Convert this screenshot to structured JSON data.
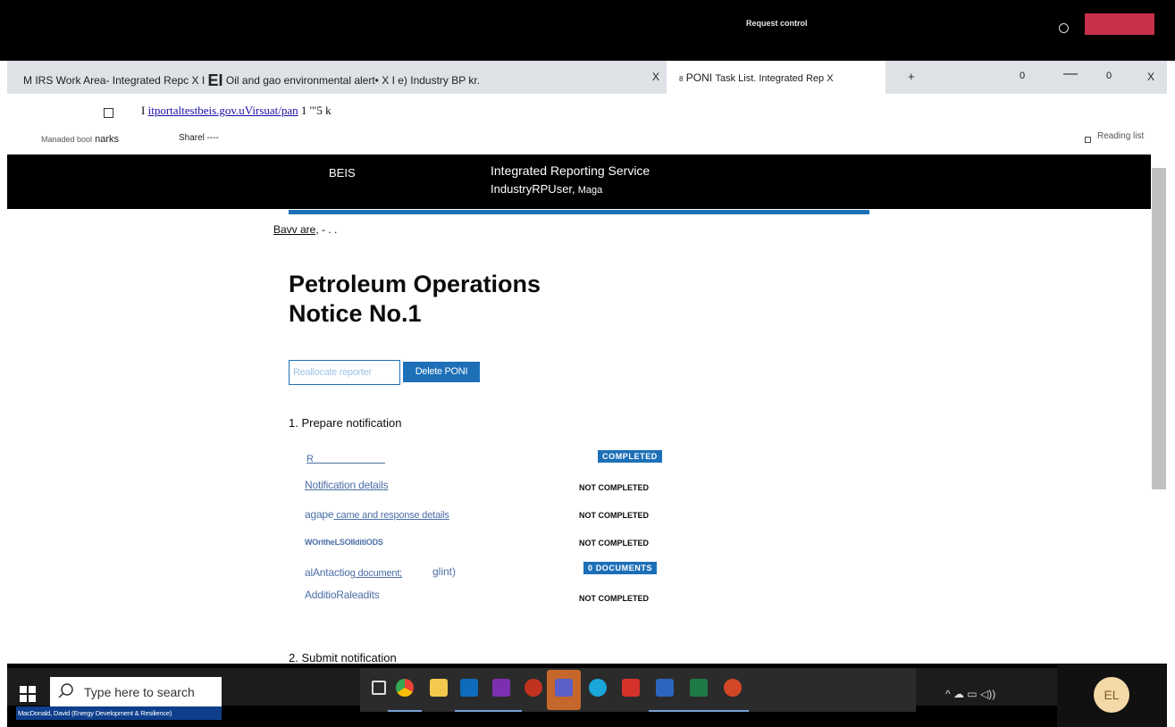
{
  "remote": {
    "request_control": "Request control"
  },
  "tabs": {
    "tab1": "M IRS Work Area- Integrated Repc X I",
    "tab2_mark": "EI",
    "tab2": " Oil and gao environmental alert• X",
    "tab3": " I e) Industry BP kr.",
    "tab_close": "X",
    "tab4_prefix": "8",
    "tab4": " PONI ",
    "tab4_rest": "Task List. Integrated Rep X",
    "new_tab": "+",
    "win_a": "0",
    "win_min": "—",
    "win_b": "0",
    "win_close": "X"
  },
  "address": {
    "prefix": "I ",
    "url": "itportaltestbeis.gov.uVirsuat/pan",
    "suffix": " 1 '\"5      k"
  },
  "bookmarks": {
    "managed_a": "Manaded bool",
    "managed_b": " narks",
    "share": "Sharel ----",
    "reading_list": "Reading list"
  },
  "header": {
    "logo": "BEIS",
    "service": "Integrated Reporting Service",
    "user": "IndustryRPUser,",
    "user_small": " Maga"
  },
  "back_link": {
    "label": "Bavv are,",
    "rest": "  - .       ."
  },
  "page_title_line1": "Petroleum Operations",
  "page_title_line2": "Notice No.1",
  "buttons": {
    "reallocate": "Reallocate reporter",
    "delete": "Delete PONI"
  },
  "section1": "1. Prepare notification",
  "section2": "2. Submit notification",
  "tasks": [
    {
      "label": "R",
      "status": "COMPLETED"
    },
    {
      "label": "Notification details",
      "status": "NOT COMPLETED"
    },
    {
      "label_a": "agape",
      "label_b": " came and response details",
      "status": "NOT COMPLETED"
    },
    {
      "label": "WOritheLSOlIditiODS",
      "status": "NOT COMPLETED"
    },
    {
      "label_a": "alAntactio",
      "label_b": "g document;",
      "extra": "glint)",
      "status": "0 DOCUMENTS"
    },
    {
      "label": "AdditioRaleadits",
      "status": "NOT COMPLETED"
    }
  ],
  "taskbar": {
    "search_placeholder": "Type here to search",
    "caption": "MacDonald, David (Energy Development & Resilience)",
    "tray": "^  ☁  ▭  ◁))",
    "avatar": "EL"
  },
  "colors": {
    "accent": "#1d70b8",
    "link": "#4c6fa7",
    "header_bg": "#000000"
  }
}
